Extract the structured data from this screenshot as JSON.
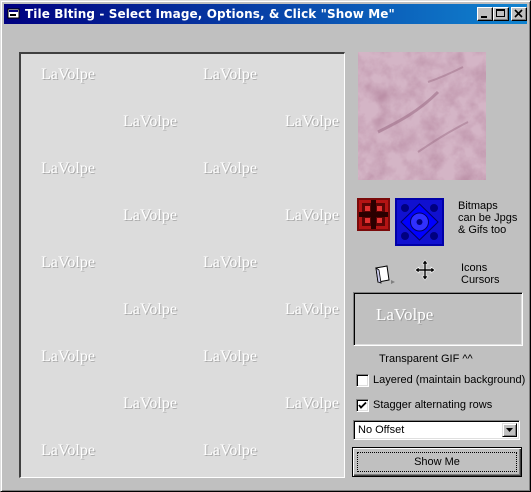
{
  "window": {
    "title": "Tile Blting - Select Image, Options, & Click \"Show Me\""
  },
  "titlebar_buttons": [
    "minimize",
    "maximize",
    "close"
  ],
  "tile_panel": {
    "watermark_text": "LaVolpe"
  },
  "bitmaps": {
    "text": "Bitmaps can be Jpgs & Gifs too"
  },
  "icons": {
    "line1": "Icons",
    "line2": "Cursors"
  },
  "transparent_gif": {
    "text": "LaVolpe",
    "caption": "Transparent GIF ^^"
  },
  "options": {
    "layered_label": "Layered (maintain background)",
    "layered_checked": false,
    "stagger_label": "Stagger alternating rows",
    "stagger_checked": true
  },
  "offset_select": {
    "value": "No Offset"
  },
  "show_button": {
    "label": "Show Me"
  },
  "colors": {
    "titlebar_start": "#000080",
    "titlebar_end": "#1084d0",
    "face": "#c0c0c0",
    "panel": "#dcdcdc",
    "preview_pink": "#b88da4"
  }
}
